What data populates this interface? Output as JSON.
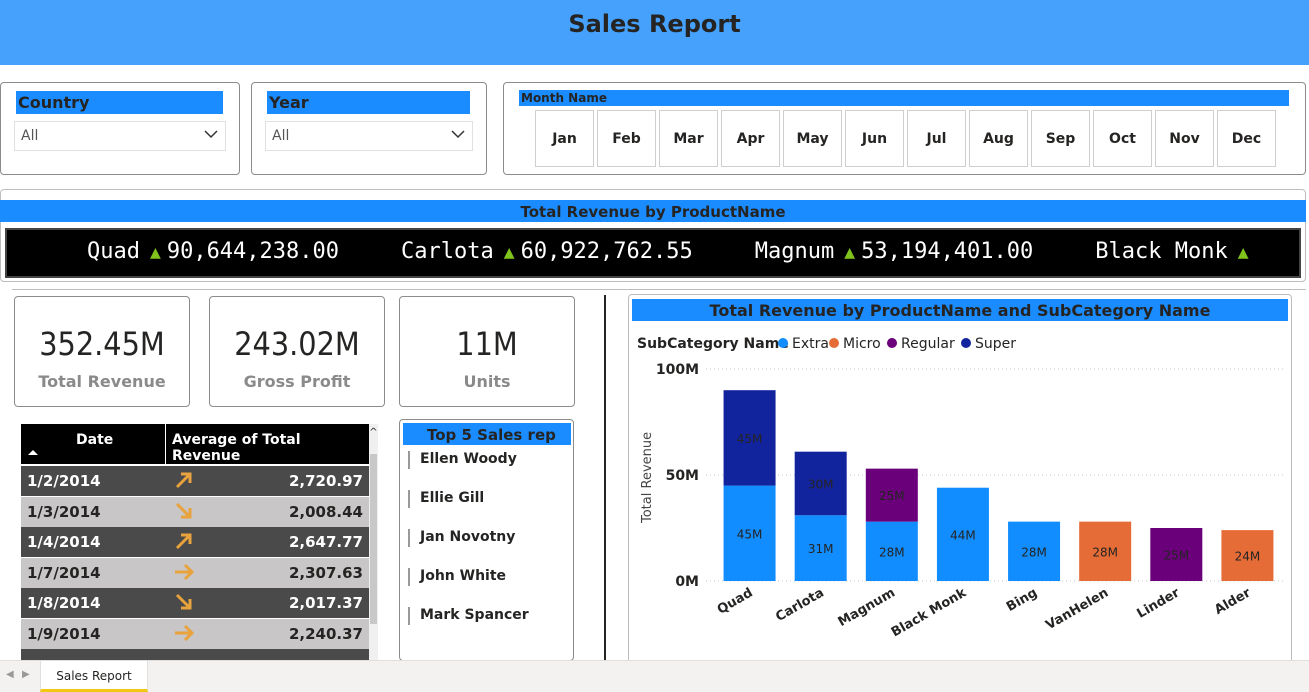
{
  "header": {
    "title": "Sales Report"
  },
  "slicers": {
    "country": {
      "label": "Country",
      "value": "All"
    },
    "year": {
      "label": "Year",
      "value": "All"
    },
    "month": {
      "label": "Month Name",
      "months": [
        "Jan",
        "Feb",
        "Mar",
        "Apr",
        "May",
        "Jun",
        "Jul",
        "Aug",
        "Sep",
        "Oct",
        "Nov",
        "Dec"
      ]
    }
  },
  "ticker": {
    "title": "Total Revenue by ProductName",
    "items": [
      {
        "name": "Quad",
        "value": "90,644,238.00"
      },
      {
        "name": "Carlota",
        "value": "60,922,762.55"
      },
      {
        "name": "Magnum",
        "value": "53,194,401.00"
      },
      {
        "name": "Black Monk",
        "value": ""
      }
    ],
    "up_glyph": "▲",
    "up_color": "#7fc31c"
  },
  "kpis": [
    {
      "value": "352.45M",
      "label": "Total Revenue"
    },
    {
      "value": "243.02M",
      "label": "Gross Profit"
    },
    {
      "value": "11M",
      "label": "Units"
    }
  ],
  "table": {
    "headers": [
      "Date",
      "Average of Total Revenue"
    ],
    "rows": [
      {
        "date": "1/2/2014",
        "trend": "up-right",
        "value": "2,720.97"
      },
      {
        "date": "1/3/2014",
        "trend": "down-right",
        "value": "2,008.44"
      },
      {
        "date": "1/4/2014",
        "trend": "up-right",
        "value": "2,647.77"
      },
      {
        "date": "1/7/2014",
        "trend": "right",
        "value": "2,307.63"
      },
      {
        "date": "1/8/2014",
        "trend": "down-right",
        "value": "2,017.37"
      },
      {
        "date": "1/9/2014",
        "trend": "right",
        "value": "2,240.37"
      }
    ],
    "arrow_color": "#e8a33d"
  },
  "top5": {
    "title": "Top 5 Sales rep",
    "reps": [
      "Ellen Woody",
      "Ellie Gill",
      "Jan Novotny",
      "John White",
      "Mark Spancer"
    ]
  },
  "chart_data": {
    "type": "bar",
    "title": "Total Revenue by ProductName and SubCategory Name",
    "legend_title": "SubCategory Name",
    "legend_position": "top-left",
    "ylabel": "Total Revenue",
    "xlabel": "",
    "ylim": [
      0,
      100
    ],
    "yticks": [
      "0M",
      "50M",
      "100M"
    ],
    "grid": true,
    "categories": [
      "Quad",
      "Carlota",
      "Magnum",
      "Black Monk",
      "Bing",
      "VanHelen",
      "Linder",
      "Alder"
    ],
    "series": [
      {
        "name": "Extra",
        "color": "#118dff",
        "values": [
          45,
          31,
          28,
          44,
          28,
          0,
          0,
          0
        ]
      },
      {
        "name": "Micro",
        "color": "#e66c37",
        "values": [
          0,
          0,
          0,
          0,
          0,
          28,
          0,
          24
        ]
      },
      {
        "name": "Regular",
        "color": "#6b007b",
        "values": [
          0,
          0,
          25,
          0,
          0,
          0,
          25,
          0
        ]
      },
      {
        "name": "Super",
        "color": "#12239e",
        "values": [
          45,
          30,
          0,
          0,
          0,
          0,
          0,
          0
        ]
      }
    ]
  },
  "page_tabs": {
    "active": "Sales Report"
  }
}
